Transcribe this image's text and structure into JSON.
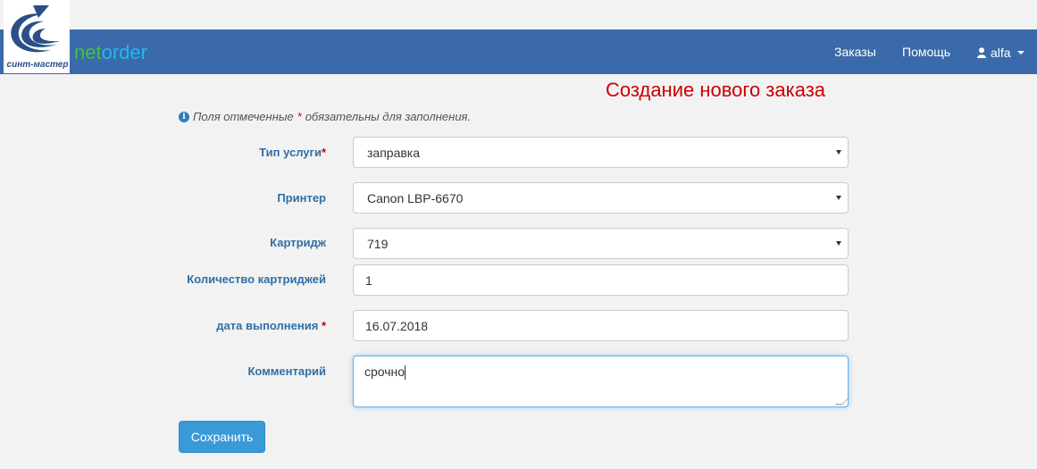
{
  "logo": {
    "caption": "синт-мастер"
  },
  "brand": {
    "net": "net",
    "order": "order"
  },
  "nav": {
    "orders": "Заказы",
    "help": "Помощь",
    "user": "alfa"
  },
  "page": {
    "title": "Создание нового заказа"
  },
  "info": {
    "text_before": "Поля отмеченные",
    "asterisk": "*",
    "text_after": "обязательны для заполнения."
  },
  "form": {
    "service_type": {
      "label": "Тип услуги",
      "required_mark": "*",
      "value": "заправка"
    },
    "printer": {
      "label": "Принтер",
      "value": "Canon LBP-6670"
    },
    "cartridge": {
      "label": "Картридж",
      "value": "719"
    },
    "quantity": {
      "label": "Количество картриджей",
      "value": "1"
    },
    "date": {
      "label": "дата выполнения",
      "required_mark": "*",
      "value": "16.07.2018"
    },
    "comment": {
      "label": "Комментарий",
      "value": "срочно"
    },
    "save_label": "Сохранить"
  },
  "colors": {
    "navbar": "#3a6aaa",
    "title": "#cc0000",
    "label": "#2f6fa7",
    "button": "#3a9ad8",
    "brand_net": "#3ec23e",
    "brand_order": "#22b8f0"
  }
}
